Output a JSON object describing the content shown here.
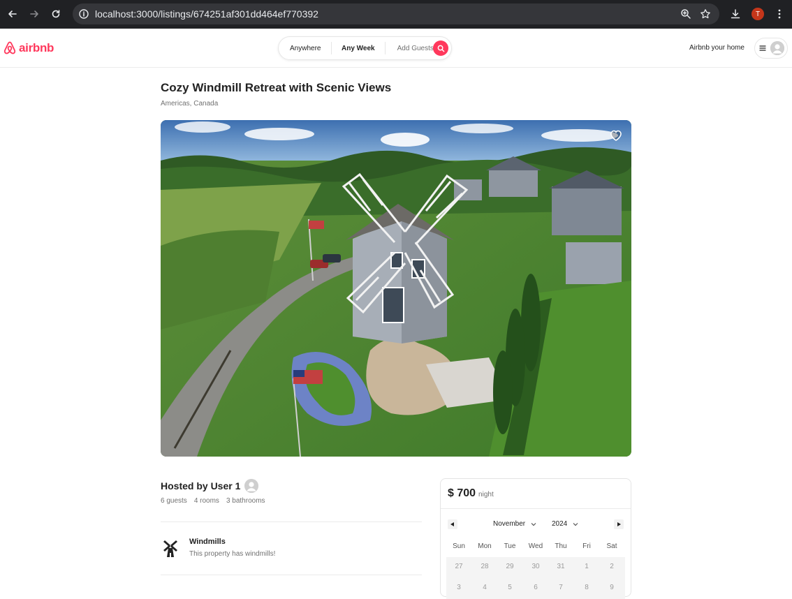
{
  "browser": {
    "url": "localhost:3000/listings/674251af301dd464ef770392",
    "profile_initial": "T"
  },
  "header": {
    "logo_text": "airbnb",
    "search": {
      "anywhere": "Anywhere",
      "any_week": "Any Week",
      "add_guests": "Add Guests"
    },
    "host_link": "Airbnb your home"
  },
  "listing": {
    "title": "Cozy Windmill Retreat with Scenic Views",
    "location": "Americas, Canada",
    "host": "Hosted by User 1",
    "stats": [
      "6 guests",
      "4 rooms",
      "3 bathrooms"
    ],
    "amenity": {
      "title": "Windmills",
      "description": "This property has windmills!"
    }
  },
  "booking": {
    "price": "$ 700",
    "per": "night",
    "month": "November",
    "year": "2024",
    "weekdays": [
      "Sun",
      "Mon",
      "Tue",
      "Wed",
      "Thu",
      "Fri",
      "Sat"
    ],
    "week1": [
      "27",
      "28",
      "29",
      "30",
      "31",
      "1",
      "2"
    ],
    "week2": [
      "3",
      "4",
      "5",
      "6",
      "7",
      "8",
      "9"
    ]
  },
  "colors": {
    "brand": "#ff385c",
    "chrome_bg": "#202124",
    "omnibox_bg": "#35363a"
  }
}
